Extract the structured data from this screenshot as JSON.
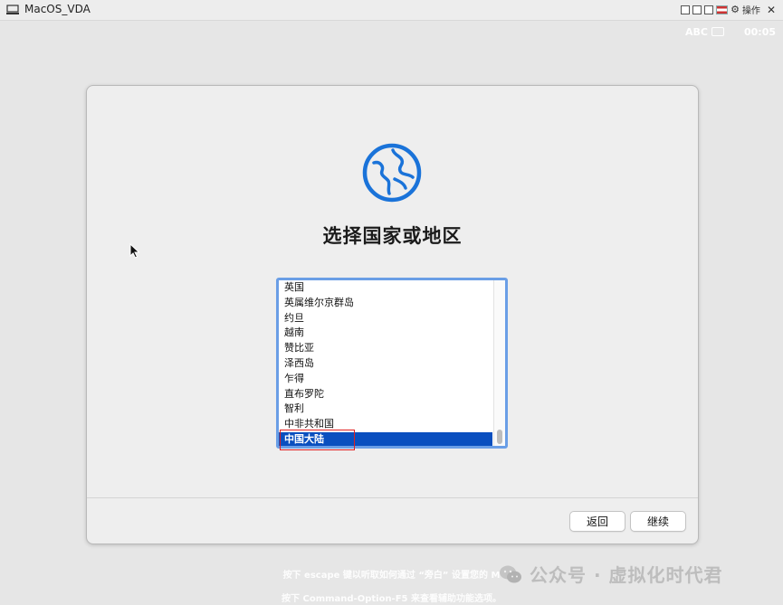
{
  "window": {
    "title": "MacOS_VDA",
    "actions_label": "操作"
  },
  "status": {
    "input_source": "ABC",
    "clock": "00:05"
  },
  "dialog": {
    "title": "选择国家或地区",
    "countries": [
      "英国",
      "英属维尔京群岛",
      "约旦",
      "越南",
      "赞比亚",
      "泽西岛",
      "乍得",
      "直布罗陀",
      "智利",
      "中非共和国",
      "中国大陆"
    ],
    "selected_country": "中国大陆",
    "back_label": "返回",
    "continue_label": "继续"
  },
  "hints": {
    "line1": "按下 escape 键以听取如何通过 “旁白” 设置您的 M",
    "line2": "按下 Command-Option-F5 来查看辅助功能选项。"
  },
  "watermark": {
    "text": "公众号 · 虚拟化时代君"
  },
  "colors": {
    "selection": "#0a4fbf",
    "list_focus_border": "#6a9ee6",
    "globe_accent": "#1a73d9",
    "annotation_red": "#e02020"
  }
}
